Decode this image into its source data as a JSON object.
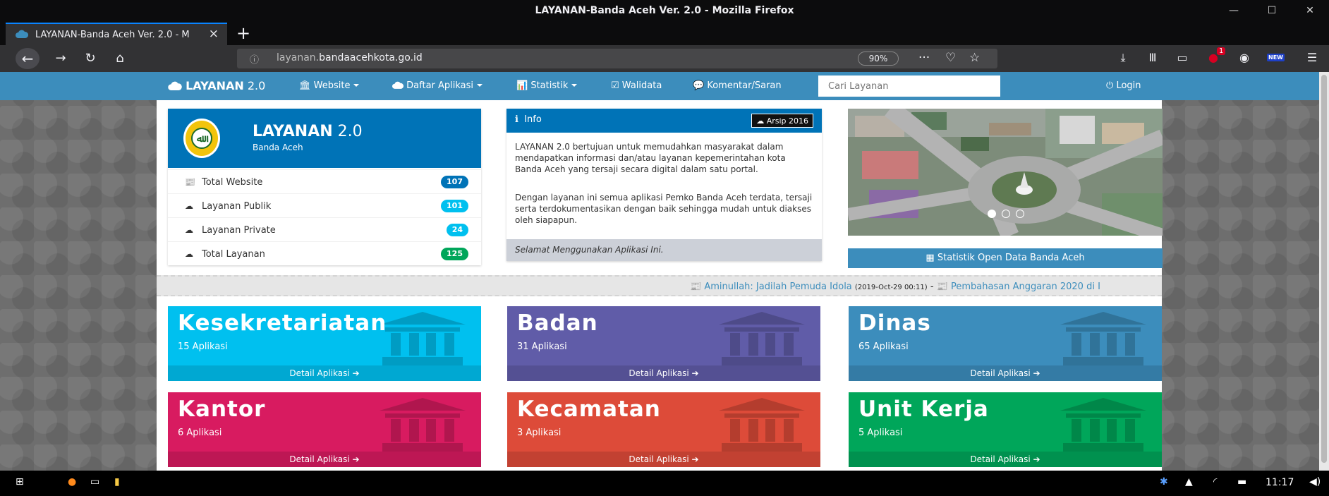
{
  "browser": {
    "window_title": "LAYANAN-Banda Aceh Ver. 2.0 - Mozilla Firefox",
    "tab_title": "LAYANAN-Banda Aceh Ver. 2.0 - M",
    "url_prefix": "layanan.",
    "url_domain": "bandaacehkota.go.id",
    "zoom": "90%",
    "ublock_count": "1",
    "new_badge": "NEW"
  },
  "site": {
    "brand_bold": "LAYANAN",
    "brand_version": " 2.0",
    "menu": [
      {
        "label": "Website"
      },
      {
        "label": "Daftar Aplikasi"
      },
      {
        "label": "Statistik"
      },
      {
        "label": "Walidata"
      },
      {
        "label": "Komentar/Saran"
      }
    ],
    "search_placeholder": "Cari Layanan",
    "login_label": "Login"
  },
  "profile": {
    "title_bold": "LAYANAN",
    "title_version": " 2.0",
    "subtitle": "Banda Aceh",
    "crest_text": "ﷲ",
    "stats": [
      {
        "label": "Total Website",
        "value": "107",
        "color": "#0073b7"
      },
      {
        "label": "Layanan Publik",
        "value": "101",
        "color": "#00c0ef"
      },
      {
        "label": "Layanan Private",
        "value": "24",
        "color": "#00c0ef"
      },
      {
        "label": "Total Layanan",
        "value": "125",
        "color": "#00a65a"
      }
    ]
  },
  "info": {
    "title": "Info",
    "archive_label": "Arsip 2016",
    "p1": "LAYANAN 2.0 bertujuan untuk memudahkan masyarakat dalam mendapatkan informasi dan/atau layanan kepemerintahan kota Banda Aceh yang tersaji secara digital dalam satu portal.",
    "p2": "Dengan layanan ini semua aplikasi Pemko Banda Aceh terdata, tersaji serta terdokumentasikan dengan baik sehingga mudah untuk diakses oleh siapapun.",
    "footer": "Selamat Menggunakan Aplikasi Ini."
  },
  "slider": {
    "active_slide": 1,
    "slide_count": 3
  },
  "stat_button_label": "Statistik Open Data Banda Aceh",
  "news": {
    "item1": "Aminullah: Jadilah Pemuda Idola",
    "item1_date": "(2019-Oct-29 00:11)",
    "separator": "-",
    "item2": "Pembahasan Anggaran 2020 di I"
  },
  "categories": [
    {
      "title": "Kesekretariatan",
      "count": "15 Aplikasi",
      "detail": "Detail Aplikasi",
      "color": "#00c0ef"
    },
    {
      "title": "Badan",
      "count": "31 Aplikasi",
      "detail": "Detail Aplikasi",
      "color": "#605ca8"
    },
    {
      "title": "Dinas",
      "count": "65 Aplikasi",
      "detail": "Detail Aplikasi",
      "color": "#3c8dbc"
    },
    {
      "title": "Kantor",
      "count": "6 Aplikasi",
      "detail": "Detail Aplikasi",
      "color": "#d81b60"
    },
    {
      "title": "Kecamatan",
      "count": "3 Aplikasi",
      "detail": "Detail Aplikasi",
      "color": "#dd4b39"
    },
    {
      "title": "Unit Kerja",
      "count": "5 Aplikasi",
      "detail": "Detail Aplikasi",
      "color": "#00a65a"
    }
  ],
  "taskbar": {
    "clock": "11:17"
  },
  "colors": {
    "accent": "#3c8dbc",
    "header_blue": "#0073b7"
  }
}
